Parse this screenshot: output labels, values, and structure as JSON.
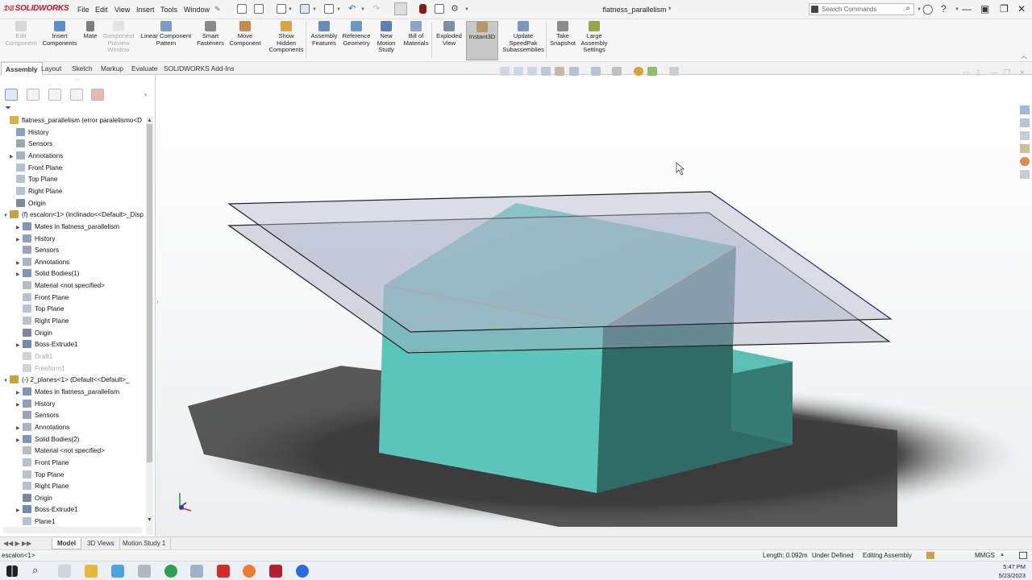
{
  "app": {
    "brand": "SOLIDWORKS",
    "document_title": "flatness_parallelism *",
    "menus": [
      "File",
      "Edit",
      "View",
      "Insert",
      "Tools",
      "Window"
    ],
    "search_placeholder": "Search Commands"
  },
  "commands": [
    {
      "label": "Edit\nComponent",
      "disabled": true,
      "icon": "edit-component-icon"
    },
    {
      "label": "Insert\nComponents",
      "disabled": false,
      "icon": "insert-components-icon"
    },
    {
      "label": "Mate",
      "disabled": false,
      "icon": "mate-icon"
    },
    {
      "label": "Component\nPreview\nWindow",
      "disabled": true,
      "icon": "component-preview-icon"
    },
    {
      "label": "Linear Component\nPattern",
      "disabled": false,
      "icon": "linear-pattern-icon"
    },
    {
      "label": "Smart\nFasteners",
      "disabled": false,
      "icon": "smart-fasteners-icon"
    },
    {
      "label": "Move\nComponent",
      "disabled": false,
      "icon": "move-component-icon"
    },
    {
      "label": "Show\nHidden\nComponents",
      "disabled": false,
      "icon": "show-hidden-icon"
    },
    {
      "label": "Assembly\nFeatures",
      "disabled": false,
      "icon": "assembly-features-icon"
    },
    {
      "label": "Reference\nGeometry",
      "disabled": false,
      "icon": "reference-geometry-icon"
    },
    {
      "label": "New\nMotion\nStudy",
      "disabled": false,
      "icon": "motion-study-icon"
    },
    {
      "label": "Bill of\nMaterials",
      "disabled": false,
      "icon": "bom-icon"
    },
    {
      "label": "Exploded\nView",
      "disabled": false,
      "icon": "exploded-view-icon"
    },
    {
      "label": "Instant3D",
      "disabled": false,
      "active": true,
      "icon": "instant3d-icon"
    },
    {
      "label": "Update\nSpeedPak\nSubassemblies",
      "disabled": false,
      "icon": "speedpak-icon"
    },
    {
      "label": "Take\nSnapshot",
      "disabled": false,
      "icon": "snapshot-icon"
    },
    {
      "label": "Large\nAssembly\nSettings",
      "disabled": false,
      "icon": "large-assembly-icon"
    }
  ],
  "tabs": [
    "Assembly",
    "Layout",
    "Sketch",
    "Markup",
    "Evaluate",
    "SOLIDWORKS Add-Ins"
  ],
  "tree": [
    {
      "label": "flatness_parallelism  (error paralelismo<D",
      "indent": 0,
      "exp": "",
      "icon": "assembly-icon"
    },
    {
      "label": "History",
      "indent": 1,
      "exp": "",
      "icon": "history-icon"
    },
    {
      "label": "Sensors",
      "indent": 1,
      "exp": "",
      "icon": "sensors-icon"
    },
    {
      "label": "Annotations",
      "indent": 1,
      "exp": "▶",
      "icon": "annotations-icon"
    },
    {
      "label": "Front Plane",
      "indent": 1,
      "exp": "",
      "icon": "plane-icon"
    },
    {
      "label": "Top Plane",
      "indent": 1,
      "exp": "",
      "icon": "plane-icon"
    },
    {
      "label": "Right Plane",
      "indent": 1,
      "exp": "",
      "icon": "plane-icon"
    },
    {
      "label": "Origin",
      "indent": 1,
      "exp": "",
      "icon": "origin-icon"
    },
    {
      "label": "(f) escalon<1> (inclinado<<Default>_Disp",
      "indent": 0,
      "exp": "▼",
      "icon": "part-icon"
    },
    {
      "label": "Mates in flatness_parallelism",
      "indent": 2,
      "exp": "▶",
      "icon": "mates-icon"
    },
    {
      "label": "History",
      "indent": 2,
      "exp": "▶",
      "icon": "history-icon"
    },
    {
      "label": "Sensors",
      "indent": 2,
      "exp": "",
      "icon": "sensors-icon"
    },
    {
      "label": "Annotations",
      "indent": 2,
      "exp": "▶",
      "icon": "annotations-icon"
    },
    {
      "label": "Solid Bodies(1)",
      "indent": 2,
      "exp": "▶",
      "icon": "solid-bodies-icon"
    },
    {
      "label": "Material <not specified>",
      "indent": 2,
      "exp": "",
      "icon": "material-icon"
    },
    {
      "label": "Front Plane",
      "indent": 2,
      "exp": "",
      "icon": "plane-icon"
    },
    {
      "label": "Top Plane",
      "indent": 2,
      "exp": "",
      "icon": "plane-icon"
    },
    {
      "label": "Right Plane",
      "indent": 2,
      "exp": "",
      "icon": "plane-icon"
    },
    {
      "label": "Origin",
      "indent": 2,
      "exp": "",
      "icon": "origin-icon"
    },
    {
      "label": "Boss-Extrude1",
      "indent": 2,
      "exp": "▶",
      "icon": "extrude-icon"
    },
    {
      "label": "Draft1",
      "indent": 2,
      "exp": "",
      "icon": "draft-icon",
      "dim": true
    },
    {
      "label": "Freeform1",
      "indent": 2,
      "exp": "",
      "icon": "freeform-icon",
      "dim": true
    },
    {
      "label": "(-) 2_planes<1> (Default<<Default>_",
      "indent": 0,
      "exp": "▼",
      "icon": "part-icon"
    },
    {
      "label": "Mates in flatness_parallelism",
      "indent": 2,
      "exp": "▶",
      "icon": "mates-icon"
    },
    {
      "label": "History",
      "indent": 2,
      "exp": "▶",
      "icon": "history-icon"
    },
    {
      "label": "Sensors",
      "indent": 2,
      "exp": "",
      "icon": "sensors-icon"
    },
    {
      "label": "Annotations",
      "indent": 2,
      "exp": "▶",
      "icon": "annotations-icon"
    },
    {
      "label": "Solid Bodies(2)",
      "indent": 2,
      "exp": "▶",
      "icon": "solid-bodies-icon"
    },
    {
      "label": "Material <not specified>",
      "indent": 2,
      "exp": "",
      "icon": "material-icon"
    },
    {
      "label": "Front Plane",
      "indent": 2,
      "exp": "",
      "icon": "plane-icon"
    },
    {
      "label": "Top Plane",
      "indent": 2,
      "exp": "",
      "icon": "plane-icon"
    },
    {
      "label": "Right Plane",
      "indent": 2,
      "exp": "",
      "icon": "plane-icon"
    },
    {
      "label": "Origin",
      "indent": 2,
      "exp": "",
      "icon": "origin-icon"
    },
    {
      "label": "Boss-Extrude1",
      "indent": 2,
      "exp": "▶",
      "icon": "extrude-icon"
    },
    {
      "label": "Plane1",
      "indent": 2,
      "exp": "",
      "icon": "plane-icon"
    }
  ],
  "bottom_tabs": [
    "Model",
    "3D Views",
    "Motion Study 1"
  ],
  "status": {
    "left": "escalon<1>",
    "length": "Length: 0.092m",
    "state": "Under Defined",
    "mode": "Editing Assembly",
    "units": "MMGS"
  },
  "clock": {
    "time": "5:47 PM",
    "date": "5/23/2023"
  },
  "colors": {
    "brand_red": "#c8102e",
    "part_teal": "#5fc7bd",
    "part_teal_dark": "#3a7e75",
    "plane_fill": "#b4b8cc"
  }
}
